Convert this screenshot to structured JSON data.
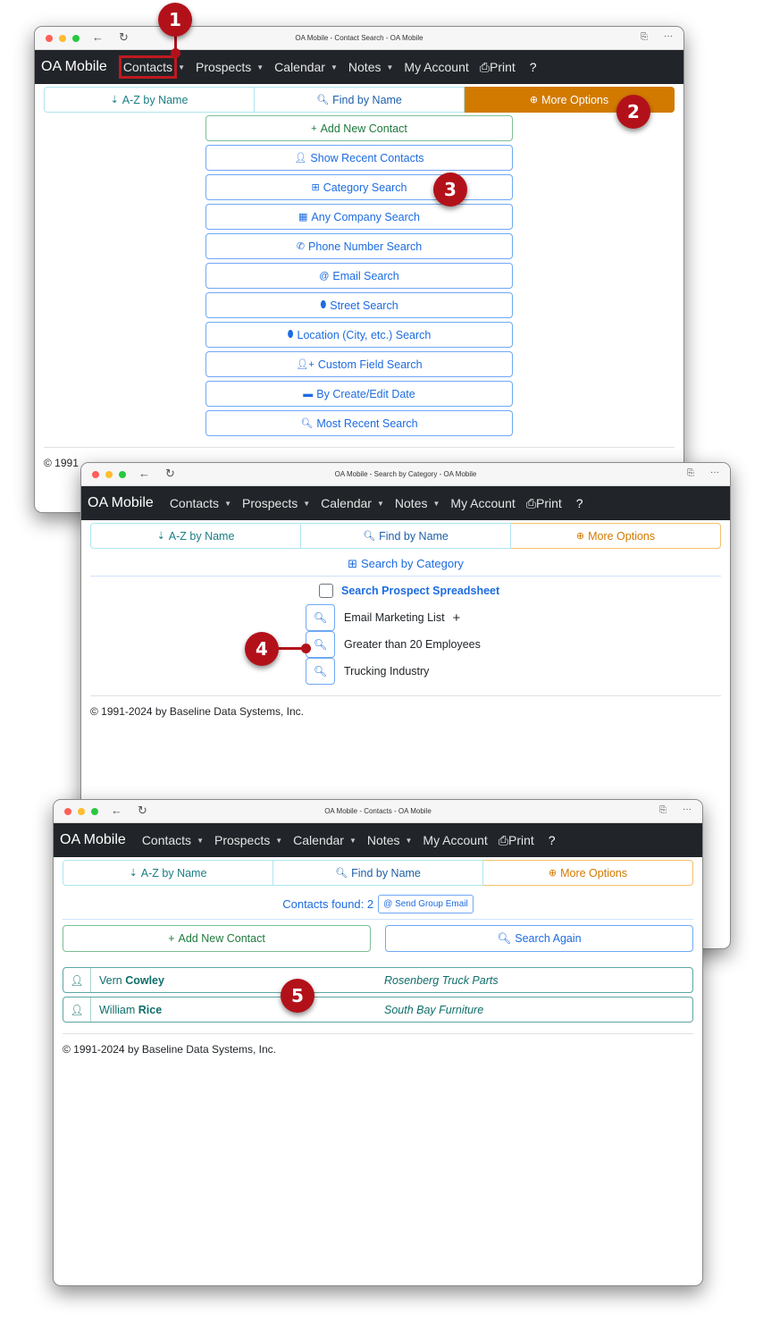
{
  "windows": [
    {
      "title": "OA Mobile - Contact Search - OA Mobile",
      "navbar": {
        "brand": "OA Mobile",
        "items": [
          "Contacts",
          "Prospects",
          "Calendar",
          "Notes"
        ],
        "account": "My Account",
        "print": "Print",
        "help": "?"
      },
      "tabs": {
        "az": "A-Z by Name",
        "find": "Find by Name",
        "more": "More Options"
      },
      "options": [
        {
          "icon": "plus-icon",
          "label": "Add New Contact"
        },
        {
          "icon": "user-icon",
          "label": "Show Recent Contacts"
        },
        {
          "icon": "table-icon",
          "label": "Category Search"
        },
        {
          "icon": "building-icon",
          "label": "Any Company Search"
        },
        {
          "icon": "phone-icon",
          "label": "Phone Number Search"
        },
        {
          "icon": "at-icon",
          "label": "Email Search"
        },
        {
          "icon": "map-marker-icon",
          "label": "Street Search"
        },
        {
          "icon": "map-marker-icon",
          "label": "Location (City, etc.) Search"
        },
        {
          "icon": "user-plus-icon",
          "label": "Custom Field Search"
        },
        {
          "icon": "calendar-icon",
          "label": "By Create/Edit Date"
        },
        {
          "icon": "search-icon",
          "label": "Most Recent Search"
        }
      ],
      "footer_partial": "© 1991"
    },
    {
      "title": "OA Mobile - Search by Category - OA Mobile",
      "navbar": {
        "brand": "OA Mobile",
        "items": [
          "Contacts",
          "Prospects",
          "Calendar",
          "Notes"
        ],
        "account": "My Account",
        "print": "Print",
        "help": "?"
      },
      "tabs": {
        "az": "A-Z by Name",
        "find": "Find by Name",
        "more": "More Options"
      },
      "heading": "Search by Category",
      "spreadsheet_label": "Search Prospect Spreadsheet",
      "categories": [
        "Email Marketing List",
        "Greater than 20 Employees",
        "Trucking Industry"
      ],
      "footer": "© 1991-2024 by Baseline Data Systems, Inc."
    },
    {
      "title": "OA Mobile - Contacts - OA Mobile",
      "navbar": {
        "brand": "OA Mobile",
        "items": [
          "Contacts",
          "Prospects",
          "Calendar",
          "Notes"
        ],
        "account": "My Account",
        "print": "Print",
        "help": "?"
      },
      "tabs": {
        "az": "A-Z by Name",
        "find": "Find by Name",
        "more": "More Options"
      },
      "found_label": "Contacts found: 2",
      "group_email": "Send Group Email",
      "add_new": "Add New Contact",
      "search_again": "Search Again",
      "contacts": [
        {
          "first": "Vern",
          "last": "Cowley",
          "company": "Rosenberg Truck Parts"
        },
        {
          "first": "William",
          "last": "Rice",
          "company": "South Bay Furniture"
        }
      ],
      "footer": "© 1991-2024 by Baseline Data Systems, Inc."
    }
  ],
  "callouts": [
    "1",
    "2",
    "3",
    "4",
    "5"
  ],
  "colors": {
    "accent_orange": "#d27a00",
    "callout_red": "#b3111a",
    "link_blue": "#1d6ce0",
    "teal": "#0e6e6a",
    "navbar": "#212529"
  }
}
